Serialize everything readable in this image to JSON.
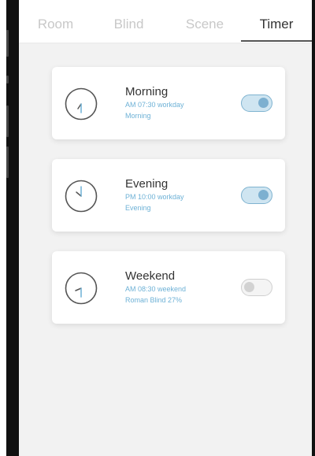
{
  "tabs": [
    {
      "label": "Room"
    },
    {
      "label": "Blind"
    },
    {
      "label": "Scene"
    },
    {
      "label": "Timer"
    }
  ],
  "active_tab": "Timer",
  "timers": [
    {
      "name": "Morning",
      "schedule": "AM 07:30 workday",
      "detail": "Morning",
      "enabled": true,
      "icon": "clock-icon"
    },
    {
      "name": "Evening",
      "schedule": "PM 10:00 workday",
      "detail": "Evening",
      "enabled": true,
      "icon": "clock-icon"
    },
    {
      "name": "Weekend",
      "schedule": "AM 08:30 weekend",
      "detail": "Roman Blind 27%",
      "enabled": false,
      "icon": "clock-icon"
    }
  ],
  "colors": {
    "accent": "#6db1d6",
    "toggle_on": "#7db0d0",
    "toggle_off": "#d2d2d2",
    "background": "#f2f2f2"
  }
}
